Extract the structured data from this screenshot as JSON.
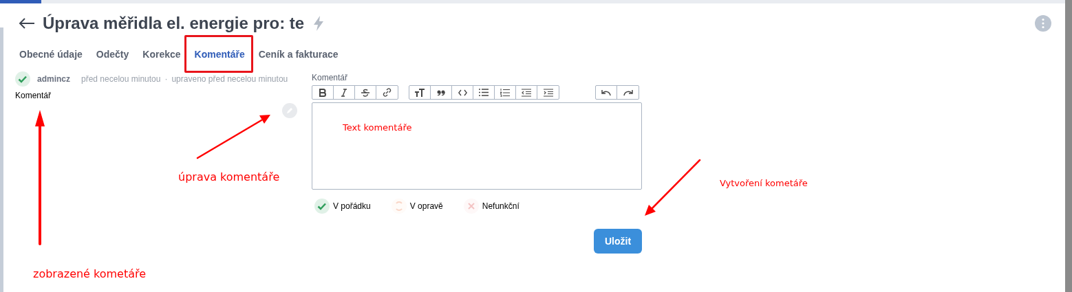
{
  "header": {
    "title": "Úprava měřidla el. energie pro: te"
  },
  "tabs": [
    {
      "label": "Obecné údaje",
      "selected": false,
      "highlighted": false
    },
    {
      "label": "Odečty",
      "selected": false,
      "highlighted": false
    },
    {
      "label": "Korekce",
      "selected": false,
      "highlighted": false
    },
    {
      "label": "Komentáře",
      "selected": true,
      "highlighted": true
    },
    {
      "label": "Ceník a fakturace",
      "selected": false,
      "highlighted": false
    }
  ],
  "comments": [
    {
      "author": "admincz",
      "created": "před necelou minutou",
      "separator": "·",
      "edited": "upraveno před necelou minutou",
      "text": "Komentář"
    }
  ],
  "editor": {
    "label": "Komentář",
    "content": "Text komentáře"
  },
  "statuses": [
    {
      "kind": "ok",
      "label": "V pořádku",
      "selected": true
    },
    {
      "kind": "repair",
      "label": "V opravě",
      "selected": false
    },
    {
      "kind": "broken",
      "label": "Nefunkční",
      "selected": false
    }
  ],
  "save_button": "Uložit",
  "annotations": [
    {
      "text": "úprava komentáře"
    },
    {
      "text": "zobrazené kometáře"
    },
    {
      "text": "Vytvoření kometáře"
    }
  ]
}
